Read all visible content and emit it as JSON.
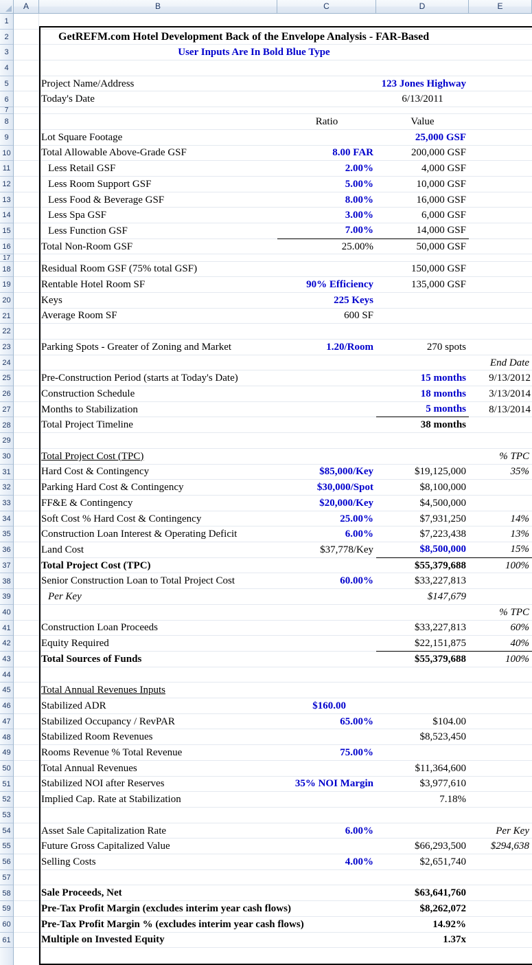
{
  "app": {
    "type": "spreadsheet",
    "column_headers": [
      "A",
      "B",
      "C",
      "D",
      "E"
    ],
    "row_numbers": [
      "1",
      "2",
      "3",
      "4",
      "5",
      "6",
      "7",
      "8",
      "9",
      "10",
      "11",
      "12",
      "13",
      "14",
      "15",
      "16",
      "17",
      "18",
      "19",
      "20",
      "21",
      "22",
      "23",
      "24",
      "25",
      "26",
      "27",
      "28",
      "29",
      "30",
      "31",
      "32",
      "33",
      "34",
      "35",
      "36",
      "37",
      "38",
      "39",
      "40",
      "41",
      "42",
      "43",
      "44",
      "45",
      "46",
      "47",
      "48",
      "49",
      "50",
      "51",
      "52",
      "53",
      "54",
      "55",
      "56",
      "57",
      "58",
      "59",
      "60",
      "61"
    ],
    "colors": {
      "input_blue": "#0000CC",
      "text_black": "#000000",
      "header_blue": "#1F3864"
    }
  },
  "title": "GetREFM.com Hotel Development Back of the Envelope Analysis - FAR-Based",
  "subtitle": "User Inputs Are In Bold Blue Type",
  "header_row": {
    "ratio": "Ratio",
    "value": "Value"
  },
  "rows": [
    {
      "n": 5,
      "label": "Project Name/Address",
      "c": "",
      "d": "123 Jones Highway",
      "e": ""
    },
    {
      "n": 6,
      "label": "Today's Date",
      "c": "",
      "d": "6/13/2011",
      "e": ""
    },
    {
      "n": 9,
      "label": "Lot Square Footage",
      "c": "",
      "d": "25,000 GSF",
      "e": ""
    },
    {
      "n": 10,
      "label": "Total Allowable Above-Grade GSF",
      "c": "8.00 FAR",
      "d": "200,000 GSF",
      "e": ""
    },
    {
      "n": 11,
      "label": "Less Retail GSF",
      "c": "2.00%",
      "d": "4,000 GSF",
      "e": ""
    },
    {
      "n": 12,
      "label": "Less Room Support GSF",
      "c": "5.00%",
      "d": "10,000 GSF",
      "e": ""
    },
    {
      "n": 13,
      "label": "Less Food & Beverage GSF",
      "c": "8.00%",
      "d": "16,000 GSF",
      "e": ""
    },
    {
      "n": 14,
      "label": "Less Spa GSF",
      "c": "3.00%",
      "d": "6,000 GSF",
      "e": ""
    },
    {
      "n": 15,
      "label": "Less Function GSF",
      "c": "7.00%",
      "d": "14,000 GSF",
      "e": ""
    },
    {
      "n": 16,
      "label": "Total Non-Room GSF",
      "c": "25.00%",
      "d": "50,000 GSF",
      "e": ""
    },
    {
      "n": 18,
      "label": "Residual Room GSF (75% total GSF)",
      "c": "",
      "d": "150,000 GSF",
      "e": ""
    },
    {
      "n": 19,
      "label": "Rentable Hotel Room SF",
      "c": "90% Efficiency",
      "d": "135,000 GSF",
      "e": ""
    },
    {
      "n": 20,
      "label": "Keys",
      "c": "225 Keys",
      "d": "",
      "e": ""
    },
    {
      "n": 21,
      "label": "Average Room SF",
      "c": "600 SF",
      "d": "",
      "e": ""
    },
    {
      "n": 23,
      "label": "Parking Spots - Greater of Zoning and Market",
      "c": "1.20/Room",
      "d": "270 spots",
      "e": ""
    },
    {
      "n": 24,
      "label": "",
      "c": "",
      "d": "",
      "e": "End Date"
    },
    {
      "n": 25,
      "label": "Pre-Construction Period (starts at Today's Date)",
      "c": "",
      "d": "15 months",
      "e": "9/13/2012"
    },
    {
      "n": 26,
      "label": "Construction Schedule",
      "c": "",
      "d": "18 months",
      "e": "3/13/2014"
    },
    {
      "n": 27,
      "label": "Months to Stabilization",
      "c": "",
      "d": "5 months",
      "e": "8/13/2014"
    },
    {
      "n": 28,
      "label": "Total Project Timeline",
      "c": "",
      "d": "38 months",
      "e": ""
    },
    {
      "n": 30,
      "label": "Total Project Cost (TPC)",
      "c": "",
      "d": "",
      "e": "% TPC"
    },
    {
      "n": 31,
      "label": "Hard Cost & Contingency",
      "c": "$85,000/Key",
      "d": "$19,125,000",
      "e": "35%"
    },
    {
      "n": 32,
      "label": "Parking Hard Cost & Contingency",
      "c": "$30,000/Spot",
      "d": "$8,100,000",
      "e": ""
    },
    {
      "n": 33,
      "label": "FF&E & Contingency",
      "c": "$20,000/Key",
      "d": "$4,500,000",
      "e": ""
    },
    {
      "n": 34,
      "label": "Soft Cost % Hard Cost & Contingency",
      "c": "25.00%",
      "d": "$7,931,250",
      "e": "14%"
    },
    {
      "n": 35,
      "label": "Construction Loan Interest & Operating Deficit",
      "c": "6.00%",
      "d": "$7,223,438",
      "e": "13%"
    },
    {
      "n": 36,
      "label": "Land Cost",
      "c": "$37,778/Key",
      "d": "$8,500,000",
      "e": "15%"
    },
    {
      "n": 37,
      "label": "Total Project Cost (TPC)",
      "c": "",
      "d": "$55,379,688",
      "e": "100%"
    },
    {
      "n": 38,
      "label": "Senior Construction Loan to Total Project Cost",
      "c": "60.00%",
      "d": "$33,227,813",
      "e": ""
    },
    {
      "n": 39,
      "label": "Per Key",
      "c": "",
      "d": "$147,679",
      "e": ""
    },
    {
      "n": 40,
      "label": "",
      "c": "",
      "d": "",
      "e": "% TPC"
    },
    {
      "n": 41,
      "label": "Construction Loan Proceeds",
      "c": "",
      "d": "$33,227,813",
      "e": "60%"
    },
    {
      "n": 42,
      "label": "Equity Required",
      "c": "",
      "d": "$22,151,875",
      "e": "40%"
    },
    {
      "n": 43,
      "label": "Total Sources of Funds",
      "c": "",
      "d": "$55,379,688",
      "e": "100%"
    },
    {
      "n": 45,
      "label": "Total Annual Revenues Inputs",
      "c": "",
      "d": "",
      "e": ""
    },
    {
      "n": 46,
      "label": "Stabilized ADR",
      "c": "$160.00",
      "d": "",
      "e": ""
    },
    {
      "n": 47,
      "label": "Stabilized Occupancy / RevPAR",
      "c": "65.00%",
      "d": "$104.00",
      "e": ""
    },
    {
      "n": 48,
      "label": "Stabilized Room Revenues",
      "c": "",
      "d": "$8,523,450",
      "e": ""
    },
    {
      "n": 49,
      "label": "Rooms Revenue % Total Revenue",
      "c": "75.00%",
      "d": "",
      "e": ""
    },
    {
      "n": 50,
      "label": "Total Annual Revenues",
      "c": "",
      "d": "$11,364,600",
      "e": ""
    },
    {
      "n": 51,
      "label": "Stabilized NOI after Reserves",
      "c": "35% NOI Margin",
      "d": "$3,977,610",
      "e": ""
    },
    {
      "n": 52,
      "label": "Implied Cap. Rate at Stabilization",
      "c": "",
      "d": "7.18%",
      "e": ""
    },
    {
      "n": 54,
      "label": "Asset Sale Capitalization Rate",
      "c": "6.00%",
      "d": "",
      "e": "Per Key"
    },
    {
      "n": 55,
      "label": "Future Gross Capitalized Value",
      "c": "",
      "d": "$66,293,500",
      "e": "$294,638"
    },
    {
      "n": 56,
      "label": "Selling Costs",
      "c": "4.00%",
      "d": "$2,651,740",
      "e": ""
    },
    {
      "n": 58,
      "label": "Sale Proceeds, Net",
      "c": "",
      "d": "$63,641,760",
      "e": ""
    },
    {
      "n": 59,
      "label": "Pre-Tax Profit Margin (excludes interim year cash flows)",
      "c": "",
      "d": "$8,262,072",
      "e": ""
    },
    {
      "n": 60,
      "label": "Pre-Tax Profit Margin % (excludes interim year cash flows)",
      "c": "",
      "d": "14.92%",
      "e": ""
    },
    {
      "n": 61,
      "label": "Multiple on Invested Equity",
      "c": "",
      "d": "1.37x",
      "e": ""
    }
  ]
}
